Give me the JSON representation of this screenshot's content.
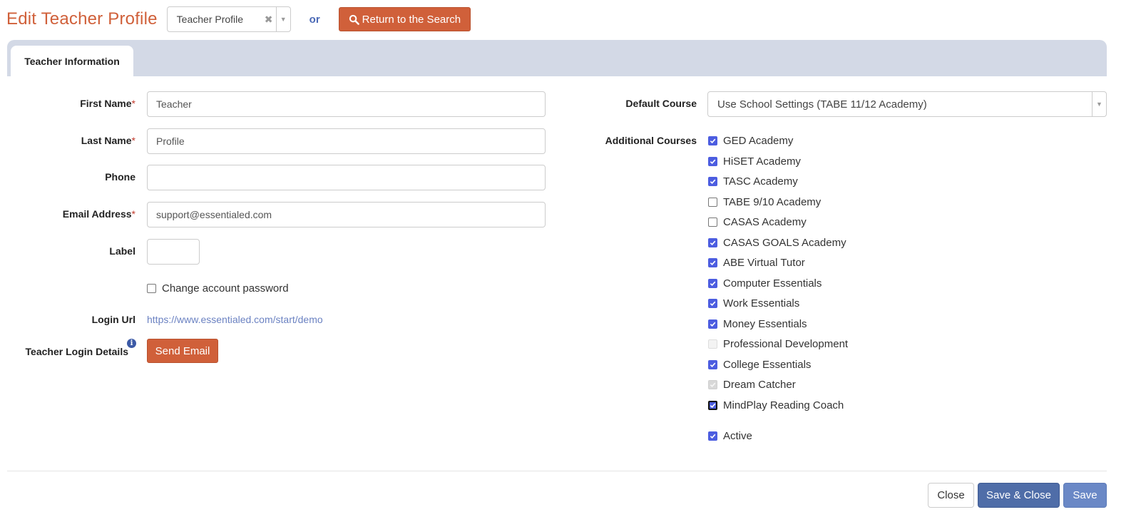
{
  "header": {
    "title": "Edit Teacher Profile",
    "profile_select_value": "Teacher Profile",
    "clear_glyph": "✖",
    "dropdown_glyph": "▼",
    "or_text": "or",
    "return_button_label": "Return to the Search"
  },
  "tabs": [
    {
      "label": "Teacher Information",
      "active": true
    }
  ],
  "form": {
    "first_name": {
      "label": "First Name",
      "required_mark": "*",
      "value": "Teacher"
    },
    "last_name": {
      "label": "Last Name",
      "required_mark": "*",
      "value": "Profile"
    },
    "phone": {
      "label": "Phone",
      "value": ""
    },
    "email": {
      "label": "Email Address",
      "required_mark": "*",
      "value": "support@essentialed.com"
    },
    "label_field": {
      "label": "Label",
      "value": ""
    },
    "change_password": {
      "label": "Change account password",
      "checked": false
    },
    "login_url": {
      "label": "Login Url",
      "value": "https://www.essentialed.com/start/demo"
    },
    "login_details": {
      "label": "Teacher Login Details",
      "info_glyph": "i",
      "button_label": "Send Email"
    }
  },
  "courses": {
    "default_label": "Default Course",
    "default_value": "Use School Settings (TABE 11/12 Academy)",
    "additional_label": "Additional Courses",
    "items": [
      {
        "label": "GED Academy",
        "state": "on"
      },
      {
        "label": "HiSET Academy",
        "state": "on"
      },
      {
        "label": "TASC Academy",
        "state": "on"
      },
      {
        "label": "TABE 9/10 Academy",
        "state": "off"
      },
      {
        "label": "CASAS Academy",
        "state": "off"
      },
      {
        "label": "CASAS GOALS Academy",
        "state": "on"
      },
      {
        "label": "ABE Virtual Tutor",
        "state": "on"
      },
      {
        "label": "Computer Essentials",
        "state": "on"
      },
      {
        "label": "Work Essentials",
        "state": "on"
      },
      {
        "label": "Money Essentials",
        "state": "on"
      },
      {
        "label": "Professional Development",
        "state": "disabled-off"
      },
      {
        "label": "College Essentials",
        "state": "on"
      },
      {
        "label": "Dream Catcher",
        "state": "disabled-on"
      },
      {
        "label": "MindPlay Reading Coach",
        "state": "focus-on"
      }
    ],
    "active": {
      "label": "Active",
      "state": "on"
    }
  },
  "footer": {
    "close_label": "Close",
    "save_close_label": "Save & Close",
    "save_label": "Save"
  },
  "colors": {
    "accent_orange": "#d0603a",
    "primary_blue": "#4f6da8",
    "save_blue": "#6a88c6",
    "checkbox_blue": "#4c5de0",
    "tabbar_bg": "#d3d9e6"
  }
}
